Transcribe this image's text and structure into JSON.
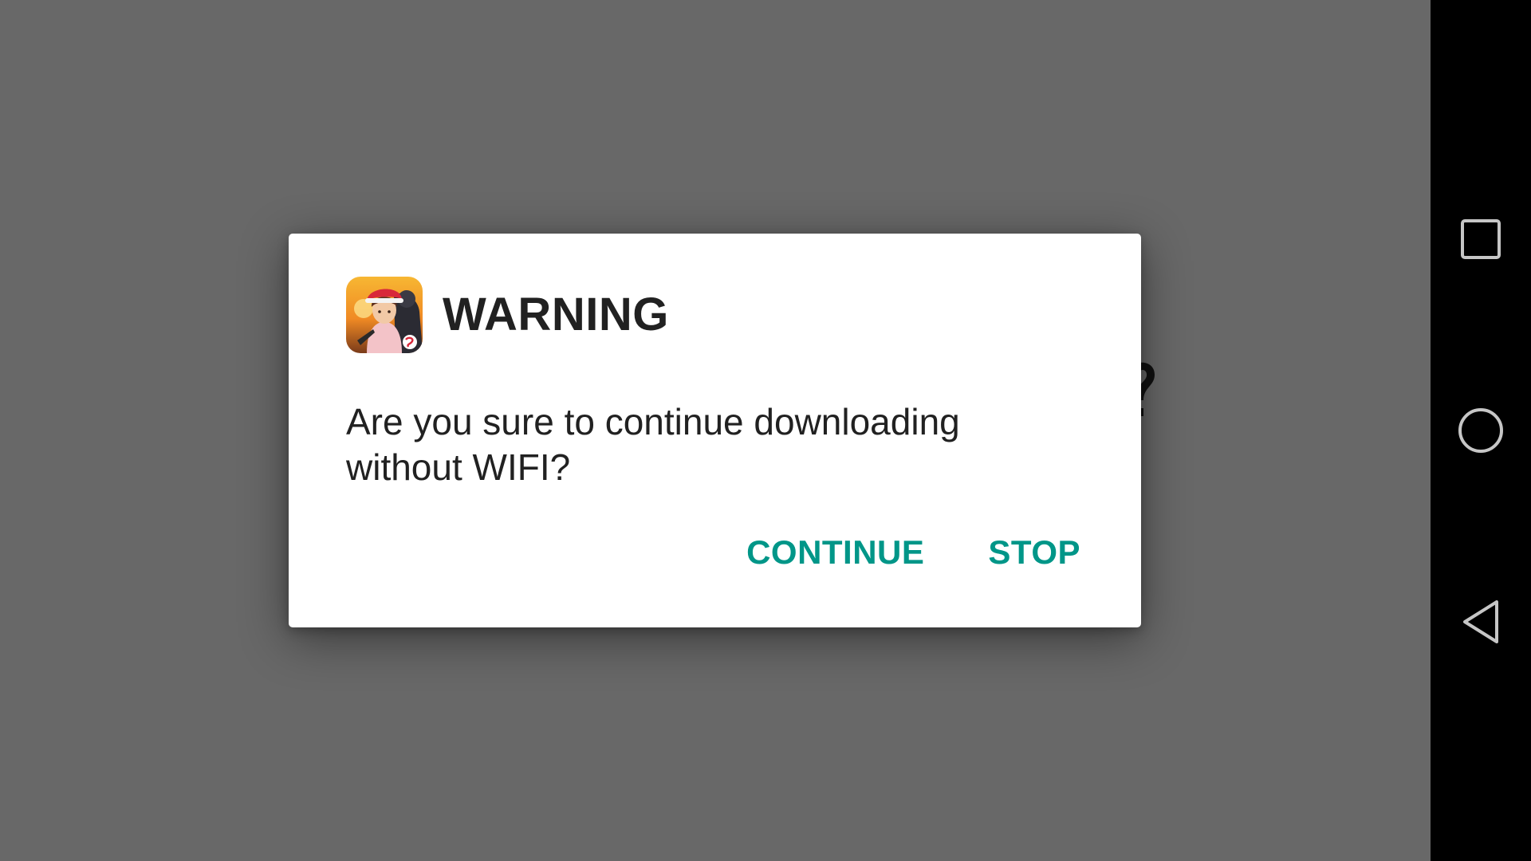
{
  "dialog": {
    "title": "WARNING",
    "message": "Are you sure to continue downloading without WIFI?",
    "buttons": {
      "continue_label": "CONTINUE",
      "stop_label": "STOP"
    },
    "icon": "game-app-icon"
  },
  "navigation": {
    "recents_icon": "square-recents-icon",
    "home_icon": "circle-home-icon",
    "back_icon": "triangle-back-icon"
  },
  "colors": {
    "scrim": "#686868",
    "dialog_bg": "#ffffff",
    "title_text": "#212121",
    "accent": "#009688",
    "navbar_bg": "#000000"
  }
}
